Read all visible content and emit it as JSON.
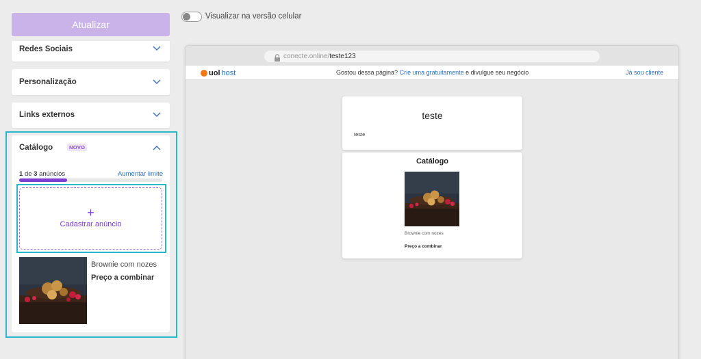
{
  "sidebar": {
    "update_button": "Atualizar",
    "sections": [
      {
        "label": "Redes Sociais",
        "icon": "chevron-down-icon"
      },
      {
        "label": "Personalização",
        "icon": "chevron-down-icon"
      },
      {
        "label": "Links externos",
        "icon": "chevron-down-icon"
      }
    ],
    "catalog": {
      "title": "Catálogo",
      "badge": "NOVO",
      "icon": "chevron-up-icon",
      "count_current": "1",
      "count_of": "de",
      "count_total": "3",
      "count_unit": "anúncios",
      "usage_fraction": 0.333,
      "increase_limit_link": "Aumentar limite",
      "add_plus": "+",
      "add_label": "Cadastrar anúncio",
      "items": [
        {
          "name": "Brownie com nozes",
          "price": "Preço a combinar"
        }
      ]
    },
    "highlight_color": "#2ab6c9",
    "accent_color": "#7b3fd1"
  },
  "preview_toggle": {
    "label": "Visualizar na versão celular",
    "checked": false
  },
  "browser": {
    "url_domain": "conecte.online/",
    "url_path": "teste123",
    "banner": {
      "brand_bold": "uol",
      "brand_host": "host",
      "message_prefix": "Gostou dessa página?",
      "message_link": "Crie uma gratuitamente",
      "message_suffix": "e divulgue seu negócio",
      "client_link": "Já sou cliente"
    },
    "site": {
      "title": "teste",
      "description": "teste",
      "catalog_title": "Catálogo",
      "item_name": "Brownie com nozes",
      "item_price": "Preço a combinar"
    }
  }
}
